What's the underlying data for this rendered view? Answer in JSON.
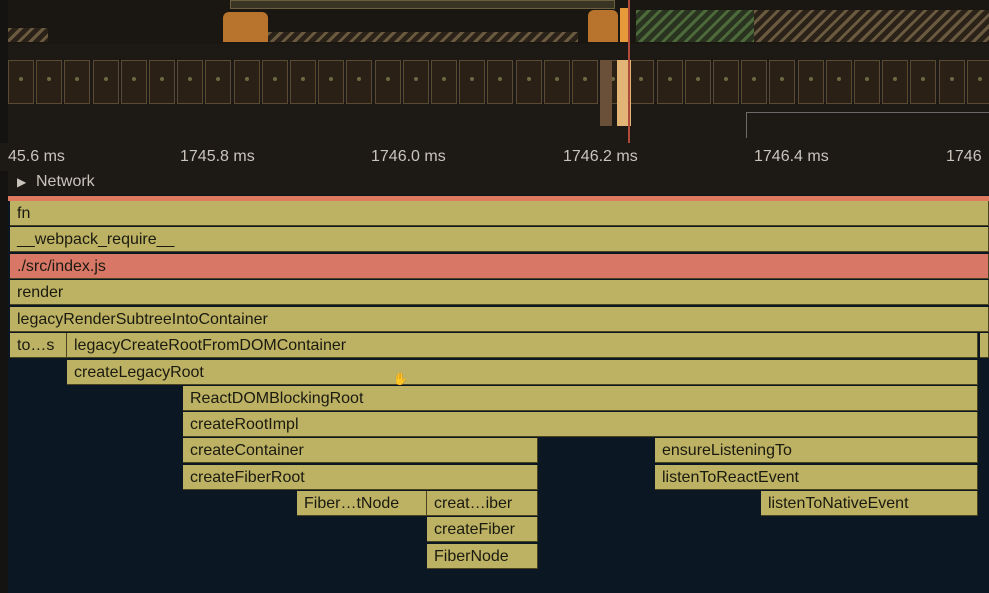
{
  "ruler": {
    "ticks": [
      "45.6 ms",
      "1745.8 ms",
      "1746.0 ms",
      "1746.2 ms",
      "1746.4 ms",
      "1746"
    ]
  },
  "network": {
    "label": "Network"
  },
  "flame": {
    "colors": {
      "olive": "#bdb263",
      "salmon": "#d97766",
      "track_bg": "#0b1722"
    },
    "frames": [
      {
        "label": "fn",
        "color": "olive"
      },
      {
        "label": "__webpack_require__",
        "color": "olive"
      },
      {
        "label": "./src/index.js",
        "color": "salmon"
      },
      {
        "label": "render",
        "color": "olive"
      },
      {
        "label": "legacyRenderSubtreeIntoContainer",
        "color": "olive"
      },
      {
        "label": "to…s",
        "color": "olive"
      },
      {
        "label": "legacyCreateRootFromDOMContainer",
        "color": "olive"
      },
      {
        "label": "createLegacyRoot",
        "color": "olive"
      },
      {
        "label": "ReactDOMBlockingRoot",
        "color": "olive"
      },
      {
        "label": "createRootImpl",
        "color": "olive"
      },
      {
        "label": "createContainer",
        "color": "olive"
      },
      {
        "label": "ensureListeningTo",
        "color": "olive"
      },
      {
        "label": "createFiberRoot",
        "color": "olive"
      },
      {
        "label": "listenToReactEvent",
        "color": "olive"
      },
      {
        "label": "Fiber…tNode",
        "color": "olive"
      },
      {
        "label": "creat…iber",
        "color": "olive"
      },
      {
        "label": "listenToNativeEvent",
        "color": "olive"
      },
      {
        "label": "createFiber",
        "color": "olive"
      },
      {
        "label": "FiberNode",
        "color": "olive"
      }
    ]
  },
  "icons": {
    "cursor": "grab-hand-icon",
    "expand": "triangle-right-icon"
  }
}
